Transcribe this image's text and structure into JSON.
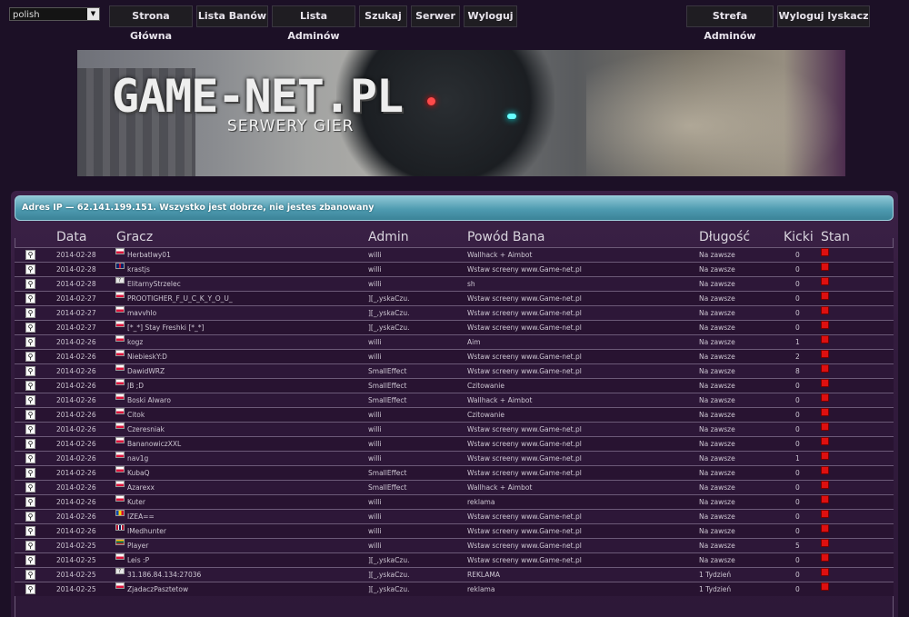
{
  "language": {
    "selected": "polish"
  },
  "nav_left": [
    "Strona Główna",
    "Lista Banów",
    "Lista Adminów",
    "Szukaj",
    "Serwer",
    "Wyloguj"
  ],
  "nav_right": [
    "Strefa Adminów",
    "Wyloguj lyskacz"
  ],
  "banner": {
    "title": "GAME-NET.PL",
    "subtitle": "SERWERY GIER"
  },
  "notice": "Adres IP — 62.141.199.151. Wszystko jest dobrze, nie jestes zbanowany",
  "columns": [
    "Data",
    "Gracz",
    "Admin",
    "Powód Bana",
    "Długość",
    "Kicki",
    "Stan"
  ],
  "bans": [
    {
      "date": "2014-02-28",
      "flag": "pl",
      "player": "Herbatlwy01",
      "admin": "willi",
      "reason": "Wallhack + Aimbot",
      "length": "Na zawsze",
      "kicks": "0"
    },
    {
      "date": "2014-02-28",
      "flag": "gb",
      "player": "krastjs",
      "admin": "willi",
      "reason": "Wstaw screeny www.Game-net.pl",
      "length": "Na zawsze",
      "kicks": "0"
    },
    {
      "date": "2014-02-28",
      "flag": "unk",
      "player": "ElitarnyStrzelec",
      "admin": "willi",
      "reason": "sh",
      "length": "Na zawsze",
      "kicks": "0"
    },
    {
      "date": "2014-02-27",
      "flag": "pl",
      "player": "PROOTIGHER_F_U_C_K_Y_O_U_",
      "admin": "][_,yskaCzu.",
      "reason": "Wstaw screeny www.Game-net.pl",
      "length": "Na zawsze",
      "kicks": "0"
    },
    {
      "date": "2014-02-27",
      "flag": "pl",
      "player": "mavvhlo",
      "admin": "][_,yskaCzu.",
      "reason": "Wstaw screeny www.Game-net.pl",
      "length": "Na zawsze",
      "kicks": "0"
    },
    {
      "date": "2014-02-27",
      "flag": "pl",
      "player": "[*_*] Stay Freshki [*_*]",
      "admin": "][_,yskaCzu.",
      "reason": "Wstaw screeny www.Game-net.pl",
      "length": "Na zawsze",
      "kicks": "0"
    },
    {
      "date": "2014-02-26",
      "flag": "pl",
      "player": "kogz",
      "admin": "willi",
      "reason": "Aim",
      "length": "Na zawsze",
      "kicks": "1"
    },
    {
      "date": "2014-02-26",
      "flag": "pl",
      "player": "NiebieskY:D",
      "admin": "willi",
      "reason": "Wstaw screeny www.Game-net.pl",
      "length": "Na zawsze",
      "kicks": "2"
    },
    {
      "date": "2014-02-26",
      "flag": "pl",
      "player": "DawidWRZ",
      "admin": "SmallEffect",
      "reason": "Wstaw screeny www.Game-net.pl",
      "length": "Na zawsze",
      "kicks": "8"
    },
    {
      "date": "2014-02-26",
      "flag": "pl",
      "player": "JB ;D",
      "admin": "SmallEffect",
      "reason": "Czitowanie",
      "length": "Na zawsze",
      "kicks": "0"
    },
    {
      "date": "2014-02-26",
      "flag": "pl",
      "player": "Boski Alwaro",
      "admin": "SmallEffect",
      "reason": "Wallhack + Aimbot",
      "length": "Na zawsze",
      "kicks": "0"
    },
    {
      "date": "2014-02-26",
      "flag": "pl",
      "player": "Citok",
      "admin": "willi",
      "reason": "Czitowanie",
      "length": "Na zawsze",
      "kicks": "0"
    },
    {
      "date": "2014-02-26",
      "flag": "pl",
      "player": "Czeresniak",
      "admin": "willi",
      "reason": "Wstaw screeny www.Game-net.pl",
      "length": "Na zawsze",
      "kicks": "0"
    },
    {
      "date": "2014-02-26",
      "flag": "pl",
      "player": "BananowiczXXL",
      "admin": "willi",
      "reason": "Wstaw screeny www.Game-net.pl",
      "length": "Na zawsze",
      "kicks": "0"
    },
    {
      "date": "2014-02-26",
      "flag": "pl",
      "player": "nav1g",
      "admin": "willi",
      "reason": "Wstaw screeny www.Game-net.pl",
      "length": "Na zawsze",
      "kicks": "1"
    },
    {
      "date": "2014-02-26",
      "flag": "pl",
      "player": "KubaQ",
      "admin": "SmallEffect",
      "reason": "Wstaw screeny www.Game-net.pl",
      "length": "Na zawsze",
      "kicks": "0"
    },
    {
      "date": "2014-02-26",
      "flag": "pl",
      "player": "Azarexx",
      "admin": "SmallEffect",
      "reason": "Wallhack + Aimbot",
      "length": "Na zawsze",
      "kicks": "0"
    },
    {
      "date": "2014-02-26",
      "flag": "pl",
      "player": "Kuter",
      "admin": "willi",
      "reason": "reklama",
      "length": "Na zawsze",
      "kicks": "0"
    },
    {
      "date": "2014-02-26",
      "flag": "md",
      "player": "IZEA==",
      "admin": "willi",
      "reason": "Wstaw screeny www.Game-net.pl",
      "length": "Na zawsze",
      "kicks": "0"
    },
    {
      "date": "2014-02-26",
      "flag": "no",
      "player": "IMedhunter",
      "admin": "willi",
      "reason": "Wstaw screeny www.Game-net.pl",
      "length": "Na zawsze",
      "kicks": "0"
    },
    {
      "date": "2014-02-25",
      "flag": "lt",
      "player": "Player",
      "admin": "willi",
      "reason": "Wstaw screeny www.Game-net.pl",
      "length": "Na zawsze",
      "kicks": "5"
    },
    {
      "date": "2014-02-25",
      "flag": "pl",
      "player": "Leis :P",
      "admin": "][_,yskaCzu.",
      "reason": "Wstaw screeny www.Game-net.pl",
      "length": "Na zawsze",
      "kicks": "0"
    },
    {
      "date": "2014-02-25",
      "flag": "unk",
      "player": "31.186.84.134:27036",
      "admin": "][_,yskaCzu.",
      "reason": "REKLAMA",
      "length": "1 Tydzień",
      "kicks": "0"
    },
    {
      "date": "2014-02-25",
      "flag": "pl",
      "player": "ZjadaczPasztetow",
      "admin": "][_,yskaCzu.",
      "reason": "reklama",
      "length": "1 Tydzień",
      "kicks": "0"
    }
  ]
}
